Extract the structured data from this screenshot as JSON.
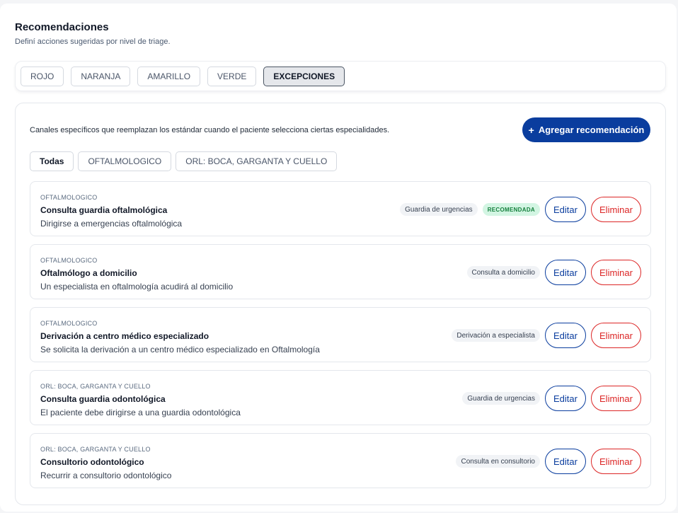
{
  "header": {
    "title": "Recomendaciones",
    "subtitle": "Definí acciones sugeridas por nivel de triage."
  },
  "triage_tabs": [
    {
      "label": "ROJO",
      "active": false
    },
    {
      "label": "NARANJA",
      "active": false
    },
    {
      "label": "AMARILLO",
      "active": false
    },
    {
      "label": "VERDE",
      "active": false
    },
    {
      "label": "EXCEPCIONES",
      "active": true
    }
  ],
  "panel": {
    "description": "Canales específicos que reemplazan los estándar cuando el paciente selecciona ciertas especialidades.",
    "add_button": {
      "icon": "plus-icon",
      "icon_glyph": "+",
      "label": "Agregar recomendación"
    }
  },
  "filters": [
    {
      "label": "Todas",
      "active": true
    },
    {
      "label": "OFTALMOLOGICO",
      "active": false
    },
    {
      "label": "ORL: BOCA, GARGANTA Y CUELLO",
      "active": false
    }
  ],
  "recommendations": [
    {
      "category": "OFTALMOLOGICO",
      "title": "Consulta guardia oftalmológica",
      "description": "Dirigirse a emergencias oftalmológica",
      "channel": "Guardia de urgencias",
      "badge": "RECOMENDADA",
      "edit_label": "Editar",
      "delete_label": "Eliminar"
    },
    {
      "category": "OFTALMOLOGICO",
      "title": "Oftalmólogo a domicilio",
      "description": "Un especialista en oftalmología acudirá al domicilio",
      "channel": "Consulta a domicilio",
      "badge": null,
      "edit_label": "Editar",
      "delete_label": "Eliminar"
    },
    {
      "category": "OFTALMOLOGICO",
      "title": "Derivación a centro médico especializado",
      "description": "Se solicita la derivación a un centro médico especializado en Oftalmología",
      "channel": "Derivación a especialista",
      "badge": null,
      "edit_label": "Editar",
      "delete_label": "Eliminar"
    },
    {
      "category": "ORL: BOCA, GARGANTA Y CUELLO",
      "title": "Consulta guardia odontológica",
      "description": "El paciente debe dirigirse a una guardia odontológica",
      "channel": "Guardia de urgencias",
      "badge": null,
      "edit_label": "Editar",
      "delete_label": "Eliminar"
    },
    {
      "category": "ORL: BOCA, GARGANTA Y CUELLO",
      "title": "Consultorio odontológico",
      "description": "Recurrir a consultorio odontológico",
      "channel": "Consulta en consultorio",
      "badge": null,
      "edit_label": "Editar",
      "delete_label": "Eliminar"
    }
  ],
  "colors": {
    "primary": "#0a3d9e",
    "danger": "#dc2626",
    "success_bg": "#d3f5e3",
    "success_text": "#15803d"
  }
}
